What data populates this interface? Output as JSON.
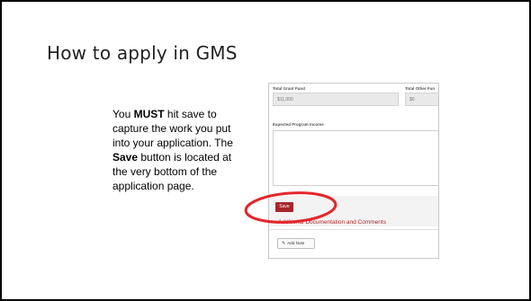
{
  "slide": {
    "title": "How to apply in GMS",
    "instructions": {
      "part1": "You ",
      "must": "MUST",
      "part2": " hit save to capture the work you put into your application. The ",
      "save": "Save",
      "part3": " button is located at the very bottom of the application page."
    }
  },
  "form": {
    "total_grant_fund_label": "Total Grant Fund",
    "total_grant_fund_value": "$11,000",
    "total_other_fund_label": "Total Other Fun",
    "total_other_fund_value": "$0",
    "expected_income_label": "Expected Program Income",
    "save_label": "Save",
    "additional_link": "Additional Documentation and Comments",
    "add_note_label": "Add Note"
  },
  "colors": {
    "save_button": "#a7262b",
    "callout_ellipse": "#e3262c",
    "link": "#b02a2a"
  },
  "icons": {
    "add_note": "pencil-icon"
  }
}
